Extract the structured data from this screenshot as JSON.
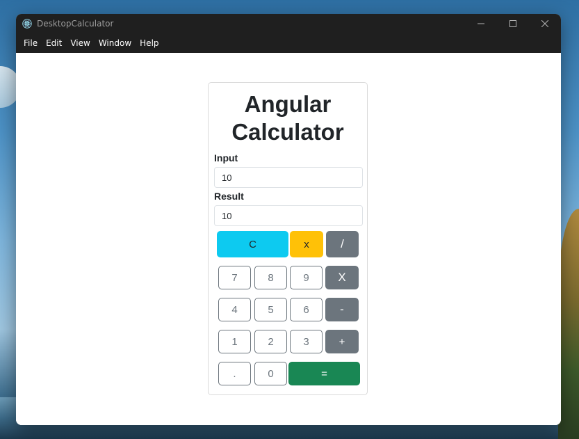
{
  "window": {
    "title": "DesktopCalculator",
    "controls": {
      "minimize": "—",
      "maximize": "☐",
      "close": "✕"
    }
  },
  "menu": [
    "File",
    "Edit",
    "View",
    "Window",
    "Help"
  ],
  "calculator": {
    "heading_line1": "Angular",
    "heading_line2": "Calculator",
    "input_label": "Input",
    "input_value": "10",
    "result_label": "Result",
    "result_value": "10"
  },
  "buttons": {
    "clear": "C",
    "backspace": "x",
    "divide": "/",
    "seven": "7",
    "eight": "8",
    "nine": "9",
    "multiply": "X",
    "four": "4",
    "five": "5",
    "six": "6",
    "subtract": "-",
    "one": "1",
    "two": "2",
    "three": "3",
    "add": "+",
    "decimal": ".",
    "zero": "0",
    "equals": "="
  },
  "colors": {
    "clear": "#0dcaf0",
    "backspace": "#ffc107",
    "operator": "#6c757d",
    "equals": "#198754",
    "titlebar": "#1f1f1f"
  }
}
